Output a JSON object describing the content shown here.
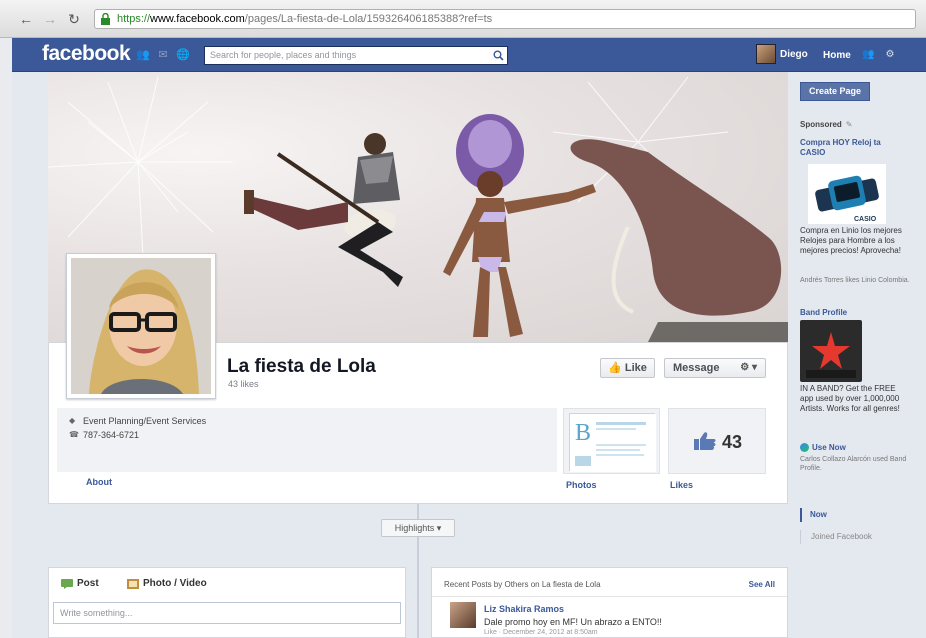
{
  "browser": {
    "url_scheme": "https://",
    "url_host": "www.facebook.com",
    "url_path": "/pages/La-fiesta-de-Lola/159326406185388?ref=ts"
  },
  "fb_header": {
    "logo": "facebook",
    "search_placeholder": "Search for people, places and things",
    "user_name": "Diego",
    "home_label": "Home"
  },
  "page": {
    "name": "La fiesta de Lola",
    "likes_subtitle": "43 likes",
    "like_button": "Like",
    "message_button": "Message",
    "category": "Event Planning/Event Services",
    "phone": "787-364-6721",
    "about_label": "About",
    "photos_label": "Photos",
    "likes_label": "Likes",
    "likes_count": "43"
  },
  "timeline": {
    "highlights_label": "Highlights",
    "composer_post_tab": "Post",
    "composer_photo_tab": "Photo / Video",
    "composer_placeholder": "Write something...",
    "recent_title": "Recent Posts by Others on La fiesta de Lola",
    "see_all": "See All",
    "post_author": "Liz Shakira Ramos",
    "post_text": "Dale promo hoy en MF! Un abrazo a ENTO!!",
    "post_meta": "Like · December 24, 2012 at 8:50am"
  },
  "sidebar": {
    "create_page": "Create Page",
    "sponsored": "Sponsored",
    "ad1_title": "Compra HOY Reloj ta CASIO",
    "ad1_text": "Compra en Linio los mejores Relojes para Hombre a los mejores precios! Aprovecha!",
    "ad1_social": "Andrés Torres likes Linio Colombia.",
    "ad2_title": "Band Profile",
    "ad2_text": "IN A BAND? Get the FREE app used by over 1,000,000 Artists. Works for all genres!",
    "ad2_use": "Use Now",
    "ad2_social": "Carlos Collazo Alarcón used Band Profile.",
    "nav_now": "Now",
    "nav_joined": "Joined Facebook"
  },
  "colors": {
    "fb_blue": "#3b5998",
    "link_blue": "#3b5998"
  }
}
